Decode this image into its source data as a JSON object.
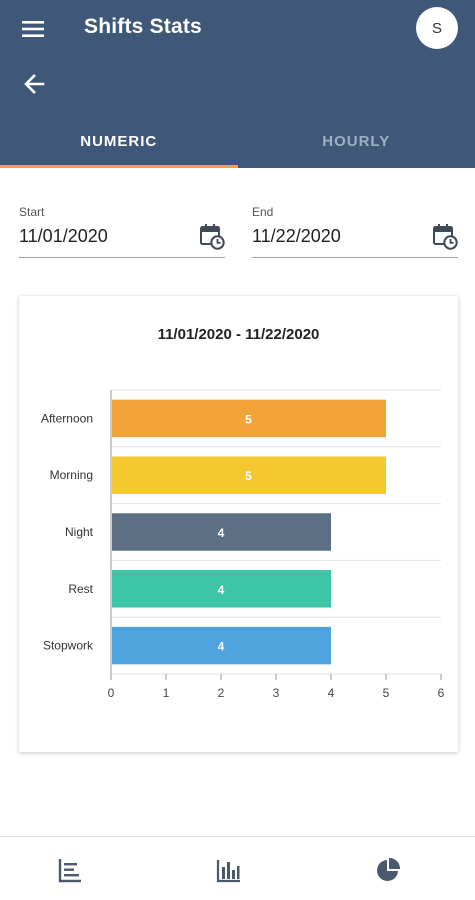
{
  "app": {
    "title": "Shifts Stats",
    "avatar_initial": "S",
    "icons": {
      "menu": "hamburger-menu-icon",
      "back": "back-arrow-icon"
    }
  },
  "tabs": [
    {
      "label": "NUMERIC",
      "active": true
    },
    {
      "label": "HOURLY",
      "active": false
    }
  ],
  "filters": {
    "start": {
      "label": "Start",
      "value": "11/01/2020",
      "icon": "calendar-clock-icon"
    },
    "end": {
      "label": "End",
      "value": "11/22/2020",
      "icon": "calendar-clock-icon"
    }
  },
  "chart_data": {
    "type": "bar",
    "orientation": "horizontal",
    "title": "11/01/2020 - 11/22/2020",
    "categories": [
      "Afternoon",
      "Morning",
      "Night",
      "Rest",
      "Stopwork"
    ],
    "values": [
      5,
      5,
      4,
      4,
      4
    ],
    "colors": [
      "#f2a33a",
      "#f4c92f",
      "#5d6f84",
      "#3ec4a6",
      "#4fa3df"
    ],
    "xlim": [
      0,
      6
    ],
    "xticks": [
      "0",
      "1",
      "2",
      "3",
      "4",
      "5",
      "6"
    ],
    "xlabel": "",
    "ylabel": "",
    "grid": true,
    "data_labels": true
  },
  "bottom_nav": [
    {
      "icon": "list-chart-icon",
      "active": true
    },
    {
      "icon": "bar-chart-icon",
      "active": false
    },
    {
      "icon": "pie-chart-icon",
      "active": false
    }
  ],
  "colors": {
    "header_bg": "#3f5877",
    "tab_indicator": "#f2a33a",
    "nav_icon": "#4a5a6c"
  }
}
